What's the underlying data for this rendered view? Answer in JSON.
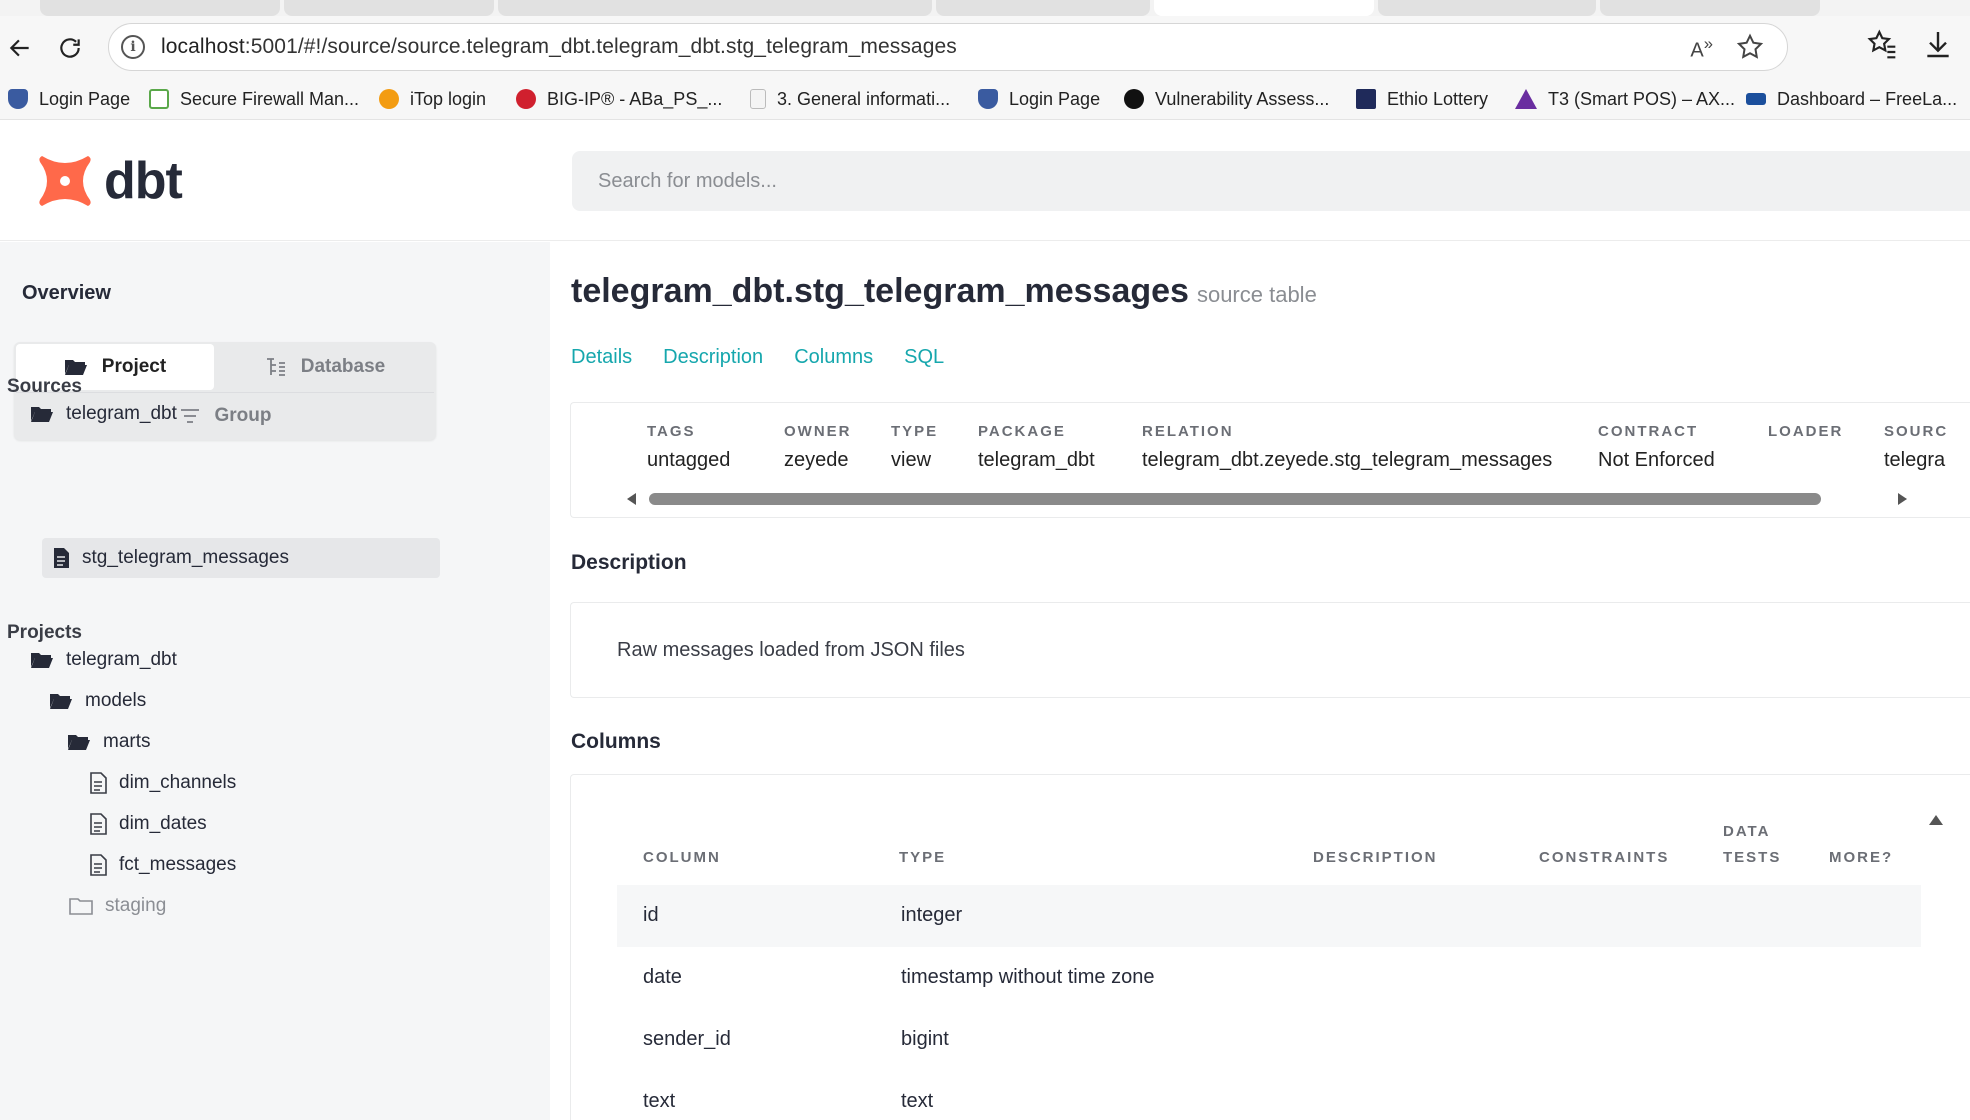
{
  "browser": {
    "url_host": "localhost",
    "url_rest": ":5001/#!/source/source.telegram_dbt.telegram_dbt.stg_telegram_messages",
    "read_aloud": "Á»",
    "bookmarks": [
      {
        "label": "Login Page",
        "color": "#3a5ba0"
      },
      {
        "label": "Secure Firewall Man...",
        "color": "#5aa84a"
      },
      {
        "label": "iTop login",
        "color": "#f39c12"
      },
      {
        "label": "BIG-IP® - ABa_PS_...",
        "color": "#d0202e"
      },
      {
        "label": "3. General informati...",
        "color": "#d9d9d9"
      },
      {
        "label": "Login Page",
        "color": "#3a5ba0"
      },
      {
        "label": "Vulnerability Assess...",
        "color": "#111111"
      },
      {
        "label": "Ethio Lottery",
        "color": "#1f2a5a"
      },
      {
        "label": "T3 (Smart POS) – AX...",
        "color": "#6a2ea0"
      },
      {
        "label": "Dashboard – FreeLa...",
        "color": "#1b4f9c"
      }
    ]
  },
  "app": {
    "logo_text": "dbt",
    "search_placeholder": "Search for models..."
  },
  "sidebar": {
    "overview": "Overview",
    "project_btn": "Project",
    "database_btn": "Database",
    "group_btn": "Group",
    "sources_title": "Sources",
    "sources": [
      {
        "label": "telegram_dbt"
      },
      {
        "label": "stg_telegram_messages"
      }
    ],
    "projects_title": "Projects",
    "projects": [
      {
        "label": "telegram_dbt"
      },
      {
        "label": "models"
      },
      {
        "label": "marts"
      },
      {
        "label": "dim_channels"
      },
      {
        "label": "dim_dates"
      },
      {
        "label": "fct_messages"
      },
      {
        "label": "staging"
      }
    ]
  },
  "main": {
    "title": "telegram_dbt.stg_telegram_messages",
    "subtitle": "source table",
    "tabs": [
      "Details",
      "Description",
      "Columns",
      "SQL"
    ],
    "details": [
      {
        "header": "TAGS",
        "value": "untagged"
      },
      {
        "header": "OWNER",
        "value": "zeyede"
      },
      {
        "header": "TYPE",
        "value": "view"
      },
      {
        "header": "PACKAGE",
        "value": "telegram_dbt"
      },
      {
        "header": "RELATION",
        "value": "telegram_dbt.zeyede.stg_telegram_messages"
      },
      {
        "header": "CONTRACT",
        "value": "Not Enforced"
      },
      {
        "header": "LOADER",
        "value": ""
      },
      {
        "header": "SOURC",
        "value": "telegra"
      }
    ],
    "description_title": "Description",
    "description_text": "Raw messages loaded from JSON files",
    "columns_title": "Columns",
    "columns_headers": {
      "column": "COLUMN",
      "type": "TYPE",
      "description": "DESCRIPTION",
      "constraints": "CONSTRAINTS",
      "data_tests_1": "DATA",
      "data_tests_2": "TESTS",
      "more": "MORE?"
    },
    "columns_rows": [
      {
        "name": "id",
        "type": "integer"
      },
      {
        "name": "date",
        "type": "timestamp without time zone"
      },
      {
        "name": "sender_id",
        "type": "bigint"
      },
      {
        "name": "text",
        "type": "text"
      }
    ]
  }
}
